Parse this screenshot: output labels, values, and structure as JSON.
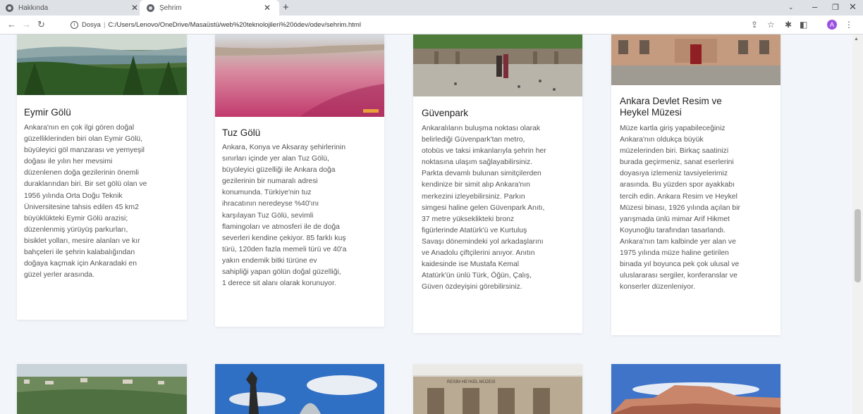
{
  "browser": {
    "tabs": [
      {
        "label": "Hakkında",
        "active": false
      },
      {
        "label": "Şehrim",
        "active": true
      }
    ],
    "new_tab": "+",
    "address": {
      "prefix": "Dosya",
      "url": "C:/Users/Lenovo/OneDrive/Masaüstü/web%20teknolojileri%20ödev/odev/sehrim.html"
    },
    "profile_initial": "A"
  },
  "cards": [
    {
      "title": "Eymir Gölü",
      "text": "Ankara'nın en çok ilgi gören doğal\ngüzelliklerinden biri olan Eymir Gölü,\nbüyüleyici göl manzarası ve yemyeşil\ndoğası ile yılın her mevsimi\ndüzenlenen doğa gezilerinin önemli\nduraklarından biri. Bir set gölü olan ve\n1956 yılında Orta Doğu Teknik\nÜniversitesine tahsis edilen 45 km2\nbüyüklükteki Eymir Gölü arazisi;\ndüzenlenmiş yürüyüş parkurları,\nbisiklet yolları, mesire alanları ve kır\nbahçeleri ile şehrin kalabalığından\ndoğaya kaçmak için Ankaradaki en\ngüzel yerler arasında."
    },
    {
      "title": "Tuz Gölü",
      "text": "Ankara, Konya ve Aksaray şehirlerinin\nsınırları içinde yer alan Tuz Gölü,\nbüyüleyici güzelliği ile Ankara doğa\ngezilerinin bir numaralı adresi\nkonumunda. Türkiye'nin tuz\nihracatının neredeyse %40'ını\nkarşılayan Tuz Gölü, sevimli\nflamingoları ve atmosferi ile de doğa\nseverleri kendine çekiyor. 85 farklı kuş\ntürü, 120den fazla memeli türü ve 40'a\nyakın endemik bitki türüne ev\nsahipliği yapan gölün doğal güzelliği,\n1 derece sit alanı olarak korunuyor."
    },
    {
      "title": "Güvenpark",
      "text": "Ankaralıların buluşma noktası olarak\nbelirlediği Güvenpark'tan metro,\notobüs ve taksi imkanlarıyla şehrin her\nnoktasına ulaşım sağlayabilirsiniz.\nParkta devamlı bulunan simitçilerden\nkendinize bir simit alıp Ankara'nın\nmerkezini izleyebilirsiniz. Parkın\nsimgesi haline gelen Güvenpark Anıtı,\n37 metre yükseklikteki bronz\nfigürlerinde Atatürk'ü ve Kurtuluş\nSavaşı dönemindeki yol arkadaşlarını\nve Anadolu çiftçilerini anıyor. Anıtın\nkaidesinde ise Mustafa Kemal\nAtatürk'ün ünlü Türk, Öğün, Çalış,\nGüven özdeyişini görebilirsiniz."
    },
    {
      "title": "Ankara Devlet Resim ve\nHeykel Müzesi",
      "text": "Müze kartla giriş yapabileceğiniz\nAnkara'nın oldukça büyük\nmüzelerinden biri. Birkaç saatinizi\nburada geçirmeniz, sanat eserlerini\ndoyasıya izlemeniz tavsiyelerimiz\narasında. Bu yüzden spor ayakkabı\ntercih edin. Ankara Resim ve Heykel\nMüzesi binası, 1926 yılında açılan bir\nyarışmada ünlü mimar Arif Hikmet\nKoyunoğlu tarafından tasarlandı.\nAnkara'nın tam kalbinde yer alan ve\n1975 yılında müze haline getirilen\nbinada yıl boyunca pek çok ulusal ve\nuluslararası sergiler, konferanslar ve\nkonserler düzenleniyor."
    }
  ],
  "museum_sign": "RESİM HEYKEL MÜZESİ"
}
